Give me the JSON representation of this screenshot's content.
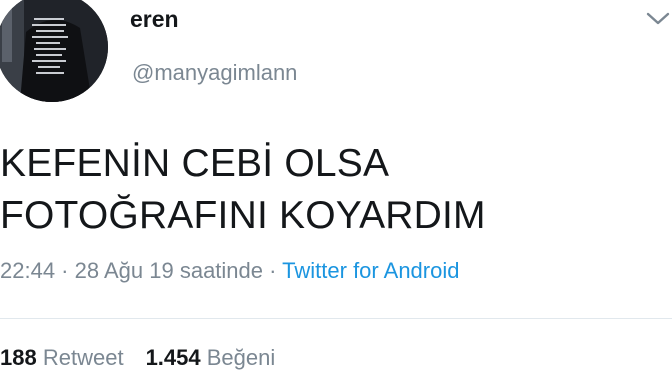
{
  "tweet": {
    "author": {
      "display_name": "eren",
      "handle": "@manyagimlann"
    },
    "text_lines": [
      "KEFENİN CEBİ OLSA",
      "FOTOĞRAFINI KOYARDIM"
    ],
    "meta": {
      "time": "22:44",
      "separator": " · ",
      "date": "28 Ağu 19 saatinde",
      "source": "Twitter for Android"
    },
    "stats": {
      "retweets_count": "188",
      "retweets_label": "Retweet",
      "likes_count": "1.454",
      "likes_label": "Beğeni"
    }
  },
  "icons": {
    "more_options": "chevron-down-icon"
  },
  "colors": {
    "text_primary": "#14171a",
    "text_secondary": "#7b8792",
    "link": "#1b95e0",
    "divider": "#e1e8ed"
  }
}
